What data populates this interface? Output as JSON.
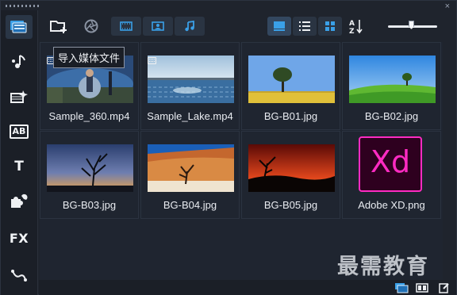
{
  "tooltip": {
    "text": "导入媒体文件"
  },
  "sidebar": {
    "items": [
      {
        "name": "media",
        "icon": "media-library-icon",
        "active": true
      },
      {
        "name": "audio",
        "icon": "music-note-icon"
      },
      {
        "name": "transition",
        "icon": "transition-icon"
      },
      {
        "name": "title",
        "icon": "title-ab-icon",
        "label": "AB"
      },
      {
        "name": "text",
        "icon": "text-t-icon",
        "label": "T"
      },
      {
        "name": "graphics",
        "icon": "puzzle-icon"
      },
      {
        "name": "filters",
        "icon": "fx-icon",
        "label": "FX"
      },
      {
        "name": "motion",
        "icon": "motion-path-icon"
      }
    ]
  },
  "toolbar": {
    "import_icon": "folder-add-icon",
    "capture_icon": "aperture-icon",
    "filters": [
      "video-filter-icon",
      "photo-filter-icon",
      "audio-filter-icon"
    ],
    "views": [
      "thumbnail-view-icon",
      "list-view-icon",
      "grid-view-icon"
    ],
    "sort_icon": "sort-az-icon",
    "zoom_level": 0.5
  },
  "media": {
    "items": [
      {
        "name": "Sample_360.mp4",
        "type": "video"
      },
      {
        "name": "Sample_Lake.mp4",
        "type": "video"
      },
      {
        "name": "BG-B01.jpg",
        "type": "image"
      },
      {
        "name": "BG-B02.jpg",
        "type": "image"
      },
      {
        "name": "BG-B03.jpg",
        "type": "image"
      },
      {
        "name": "BG-B04.jpg",
        "type": "image"
      },
      {
        "name": "BG-B05.jpg",
        "type": "image"
      },
      {
        "name": "Adobe XD.png",
        "type": "image"
      }
    ],
    "xd_logo_text": "Xd"
  },
  "watermark": "最需教育",
  "colors": {
    "accent": "#3aa0e8",
    "xd_pink": "#ff2bc2",
    "xd_bg": "#2e001f"
  }
}
